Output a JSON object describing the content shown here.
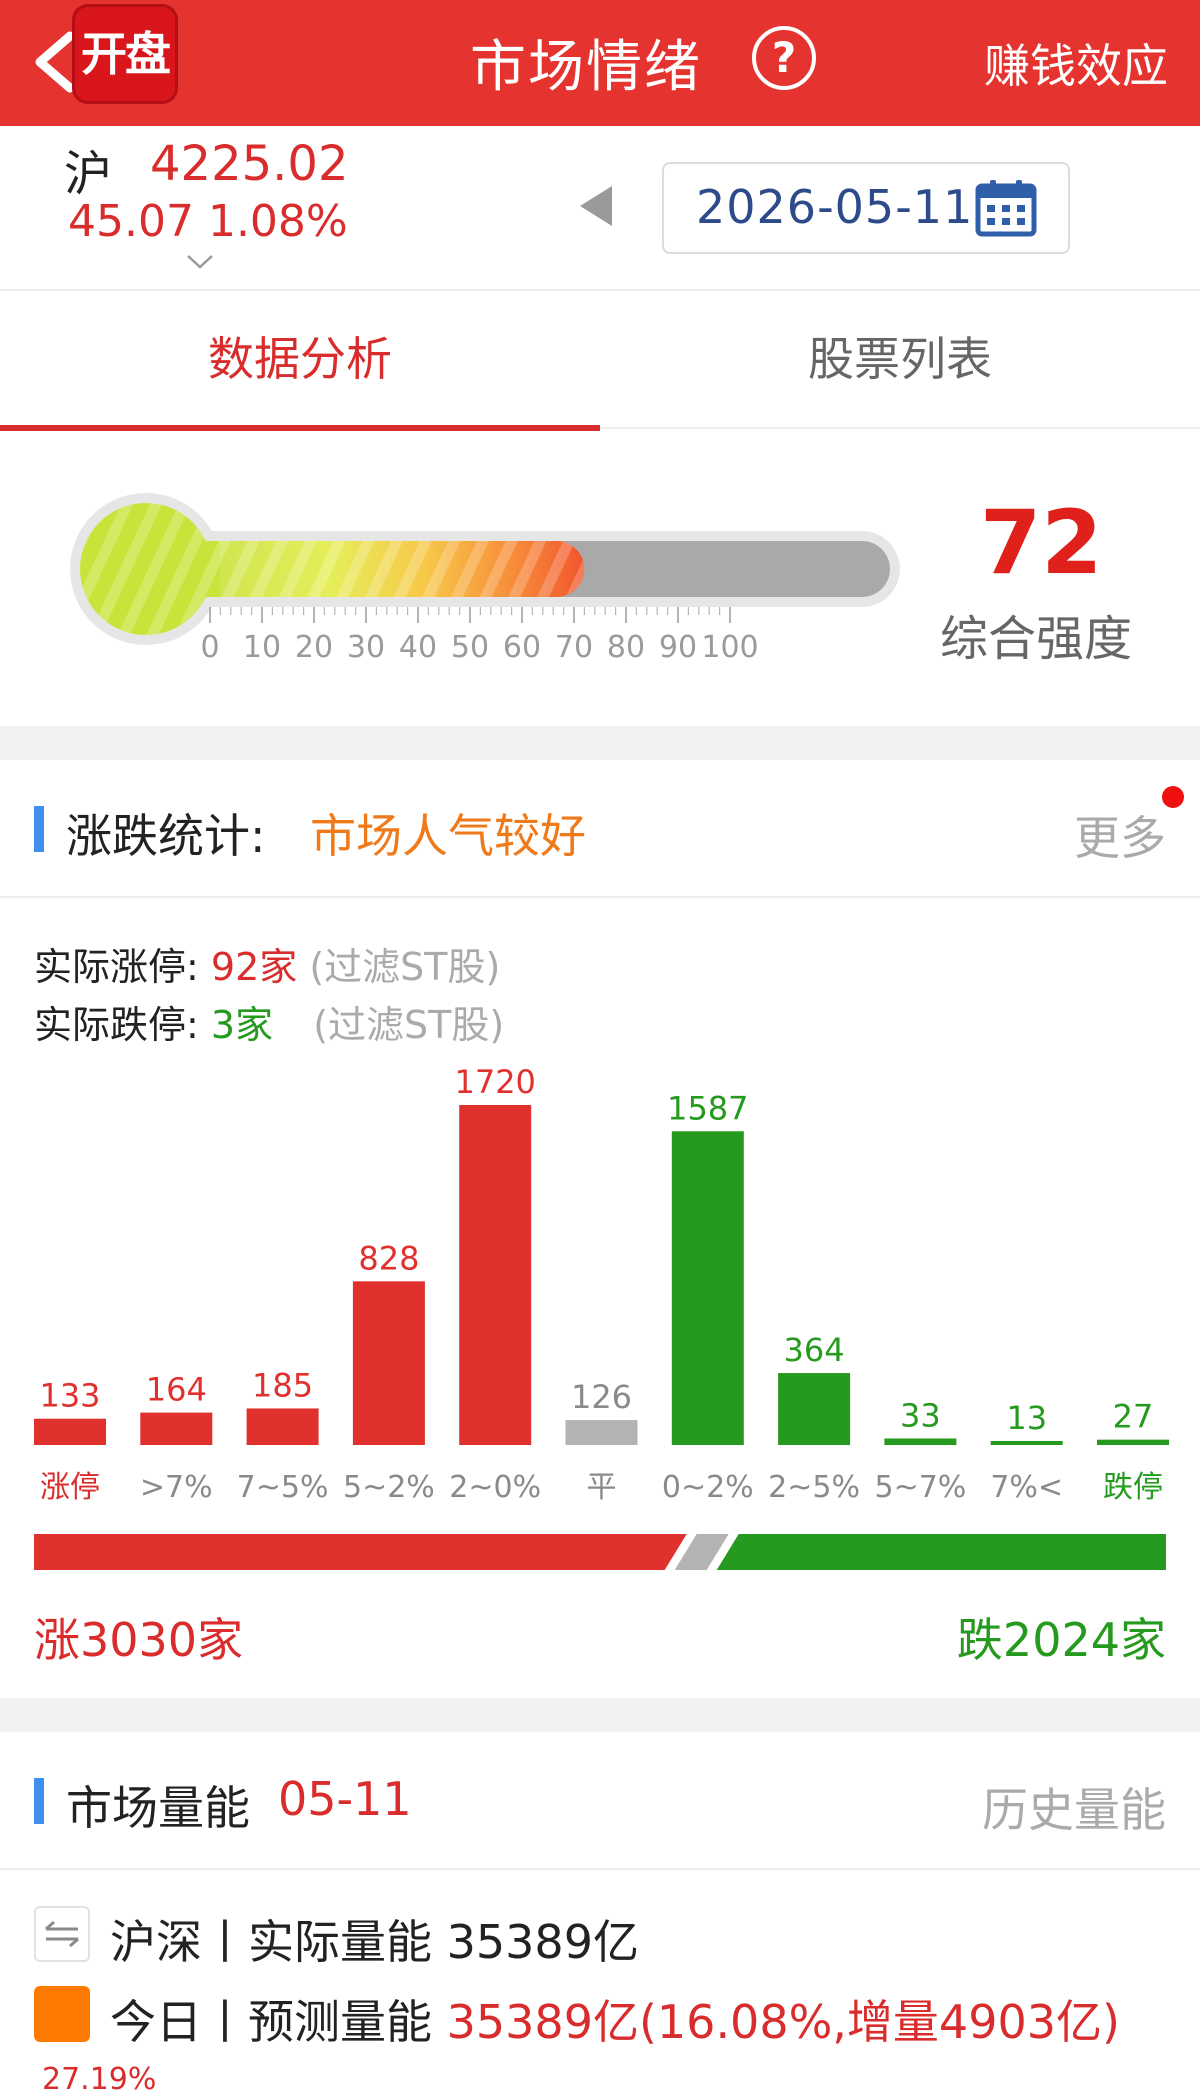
{
  "header": {
    "logo_text": "开盘",
    "title": "市场情绪",
    "help_symbol": "?",
    "right_link": "赚钱效应",
    "back_icon": "chevron-left-icon"
  },
  "index": {
    "name": "沪",
    "value": "4225.02",
    "change": "45.07  1.08%",
    "up_color": "#d92c2c"
  },
  "date": {
    "value": "2026-05-11"
  },
  "tabs": [
    {
      "label": "数据分析",
      "active": true
    },
    {
      "label": "股票列表",
      "active": false
    }
  ],
  "gauge": {
    "score": "72",
    "label": "综合强度",
    "level": 72,
    "min": 0,
    "max": 100,
    "ticks": [
      "0",
      "10",
      "20",
      "30",
      "40",
      "50",
      "60",
      "70",
      "80",
      "90",
      "100"
    ]
  },
  "stats": {
    "title": "涨跌统计:",
    "sentiment": "市场人气较好",
    "more_label": "更多",
    "limit_up_label": "实际涨停:",
    "limit_up_value": "92家",
    "limit_up_note": "(过滤ST股)",
    "limit_down_label": "实际跌停:",
    "limit_down_value": "3家",
    "limit_down_note": "(过滤ST股)",
    "rise_total": "涨3030家",
    "fall_total": "跌2024家"
  },
  "chart_data": {
    "type": "bar",
    "categories": [
      "涨停",
      ">7%",
      "7~5%",
      "5~2%",
      "2~0%",
      "平",
      "0~2%",
      "2~5%",
      "5~7%",
      "7%<",
      "跌停"
    ],
    "values": [
      133,
      164,
      185,
      828,
      1720,
      126,
      1587,
      364,
      33,
      13,
      27
    ],
    "colors": [
      "#e0312e",
      "#e0312e",
      "#e0312e",
      "#e0312e",
      "#e0312e",
      "#b3b3b3",
      "#259a1f",
      "#259a1f",
      "#259a1f",
      "#259a1f",
      "#259a1f"
    ],
    "title": "",
    "xlabel": "",
    "ylabel": ""
  },
  "split": {
    "rise": 3030,
    "fall": 2024,
    "rise_color": "#e0312e",
    "fall_color": "#259a1f",
    "flat_color": "#b3b3b3"
  },
  "volume": {
    "title": "市场量能",
    "date": "05-11",
    "history_link": "历史量能",
    "actual_prefix": "沪深丨实际量能 ",
    "actual_value": "35389亿",
    "forecast_prefix": "今日丨预测量能 ",
    "forecast_value": "35389亿(16.08%,增量4903亿)",
    "bottom_partial": "27.19%"
  }
}
